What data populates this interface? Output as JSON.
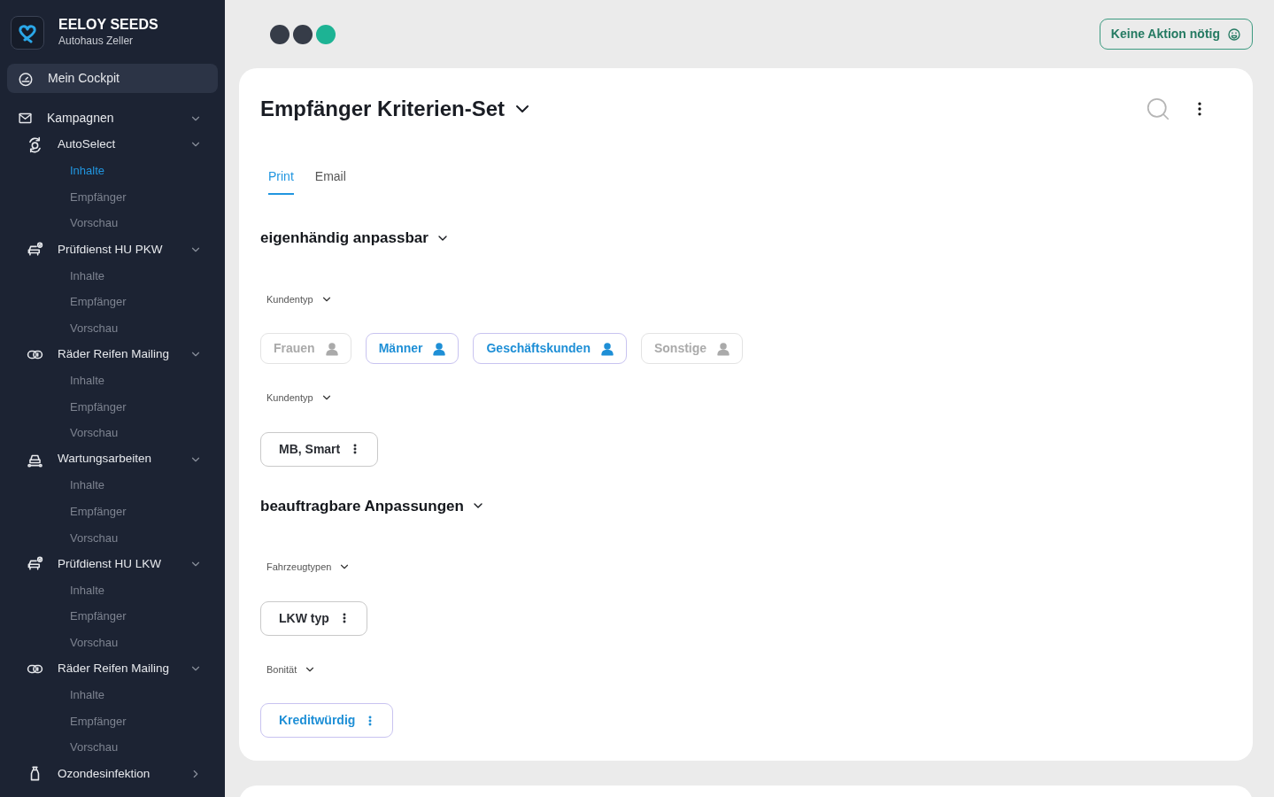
{
  "sidebar": {
    "brand": "EELOY SEEDS",
    "subtitle": "Autohaus Zeller",
    "cockpit": {
      "label": "Mein Cockpit",
      "selected": true
    },
    "groups": [
      {
        "label": "Kampagnen",
        "expanded": true,
        "campaigns": [
          {
            "label": "AutoSelect",
            "kind": "refresh",
            "expanded": true,
            "children": [
              {
                "label": "Inhalte",
                "selected": true
              },
              {
                "label": "Empfänger",
                "selected": false
              },
              {
                "label": "Vorschau",
                "selected": false
              }
            ]
          },
          {
            "label": "Prüfdienst HU PKW",
            "kind": "car-check",
            "expanded": true,
            "children": [
              {
                "label": "Inhalte",
                "selected": false
              },
              {
                "label": "Empfänger",
                "selected": false
              },
              {
                "label": "Vorschau",
                "selected": false
              }
            ]
          },
          {
            "label": "Räder Reifen Mailing",
            "kind": "tires",
            "expanded": true,
            "children": [
              {
                "label": "Inhalte",
                "selected": false
              },
              {
                "label": "Empfänger",
                "selected": false
              },
              {
                "label": "Vorschau",
                "selected": false
              }
            ]
          },
          {
            "label": "Wartungsarbeiten",
            "kind": "car-wrench",
            "expanded": true,
            "children": [
              {
                "label": "Inhalte",
                "selected": false
              },
              {
                "label": "Empfänger",
                "selected": false
              },
              {
                "label": "Vorschau",
                "selected": false
              }
            ]
          },
          {
            "label": "Prüfdienst HU LKW",
            "kind": "car-check",
            "expanded": true,
            "children": [
              {
                "label": "Inhalte",
                "selected": false
              },
              {
                "label": "Empfänger",
                "selected": false
              },
              {
                "label": "Vorschau",
                "selected": false
              }
            ]
          },
          {
            "label": "Räder Reifen Mailing",
            "kind": "tires",
            "expanded": true,
            "children": [
              {
                "label": "Inhalte",
                "selected": false
              },
              {
                "label": "Empfänger",
                "selected": false
              },
              {
                "label": "Vorschau",
                "selected": false
              }
            ]
          },
          {
            "label": "Ozondesinfektion",
            "kind": "spray",
            "expanded": false
          }
        ]
      }
    ]
  },
  "topbar": {
    "dots": [
      {
        "color": "#363c48"
      },
      {
        "color": "#363c48"
      },
      {
        "color": "#1db394"
      }
    ],
    "status_button": "Keine Aktion nötig"
  },
  "card": {
    "title": "Empfänger Kriterien-Set",
    "tabs": [
      {
        "label": "Print",
        "selected": true
      },
      {
        "label": "Email",
        "selected": false
      }
    ],
    "sections": [
      {
        "title": "eigenhändig anpassbar",
        "filters": [
          {
            "label": "Kundentyp",
            "chips": [
              {
                "label": "Frauen",
                "kind": "person",
                "selected": false
              },
              {
                "label": "Männer",
                "kind": "person",
                "selected": true
              },
              {
                "label": "Geschäftskunden",
                "kind": "person",
                "selected": true
              },
              {
                "label": "Sonstige",
                "kind": "person",
                "selected": false
              }
            ]
          },
          {
            "label": "Kundentyp",
            "chips": [
              {
                "label": "MB, Smart",
                "kind": "menu",
                "selected": false
              }
            ]
          }
        ]
      },
      {
        "title": "beauftragbare Anpassungen",
        "filters": [
          {
            "label": "Fahrzeugtypen",
            "chips": [
              {
                "label": "LKW typ",
                "kind": "menu",
                "selected": false
              }
            ]
          },
          {
            "label": "Bonität",
            "chips": [
              {
                "label": "Kreditwürdig",
                "kind": "menu",
                "selected": true
              }
            ]
          }
        ]
      }
    ]
  }
}
